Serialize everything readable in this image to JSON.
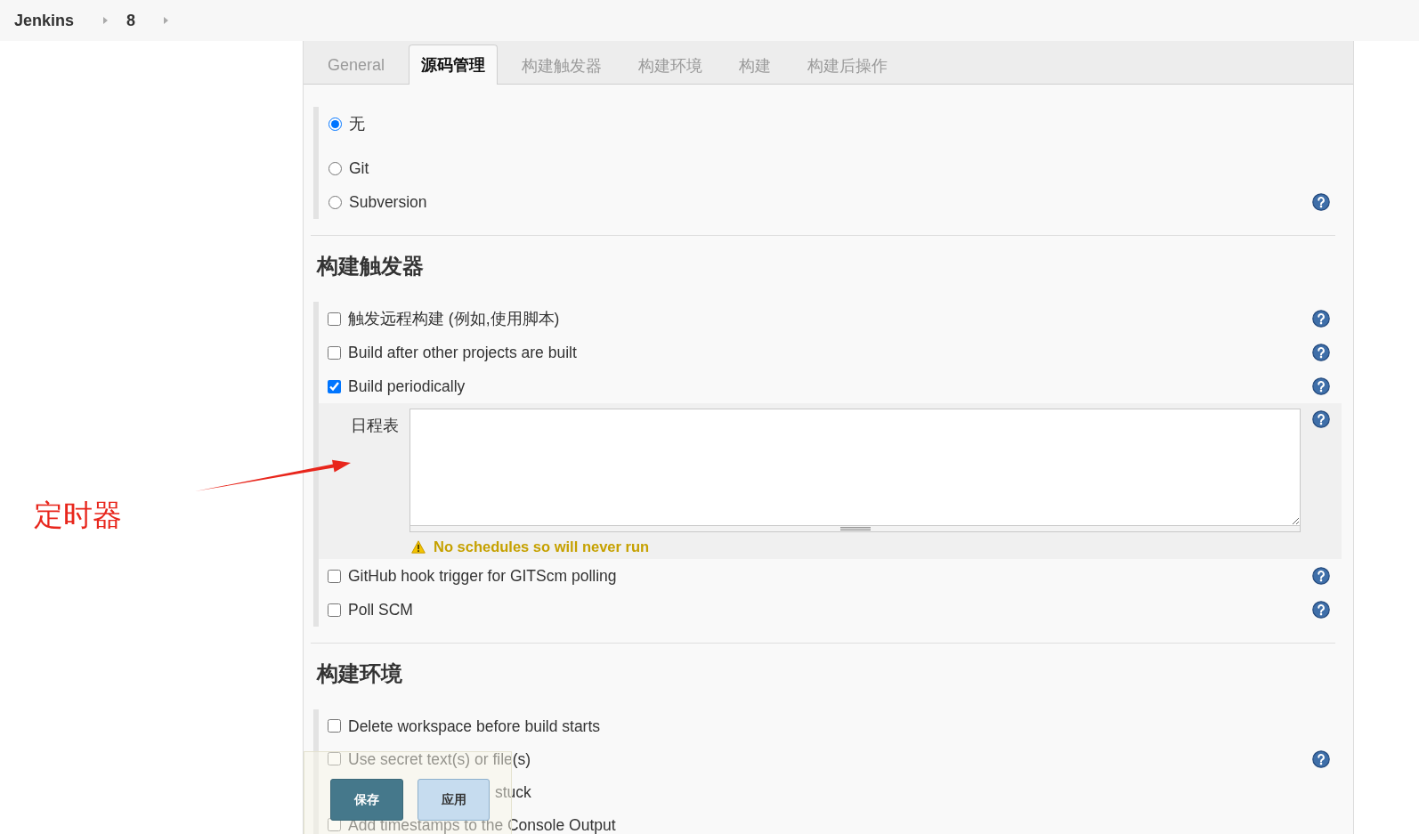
{
  "breadcrumb": [
    {
      "label": "Jenkins"
    },
    {
      "label": "8"
    }
  ],
  "tabs": [
    {
      "label": "General",
      "selected": false
    },
    {
      "label": "源码管理",
      "selected": true
    },
    {
      "label": "构建触发器",
      "selected": false
    },
    {
      "label": "构建环境",
      "selected": false
    },
    {
      "label": "构建",
      "selected": false
    },
    {
      "label": "构建后操作",
      "selected": false
    }
  ],
  "source_control": {
    "options": [
      {
        "label": "无",
        "selected": true
      },
      {
        "label": "Git",
        "selected": false
      },
      {
        "label": "Subversion",
        "selected": false,
        "help": true
      }
    ]
  },
  "sections": [
    {
      "title": "构建触发器",
      "items": [
        {
          "kind": "checkbox",
          "label": "触发远程构建 (例如,使用脚本)",
          "checked": false,
          "help": true
        },
        {
          "kind": "checkbox",
          "label": "Build after other projects are built",
          "checked": false,
          "help": true
        },
        {
          "kind": "checkbox",
          "label": "Build periodically",
          "checked": true,
          "help": true,
          "schedule": {
            "label": "日程表",
            "help": true,
            "warning": "No schedules so will never run"
          }
        },
        {
          "kind": "checkbox",
          "label": "GitHub hook trigger for GITScm polling",
          "checked": false,
          "help": true
        },
        {
          "kind": "checkbox",
          "label": "Poll SCM",
          "checked": false,
          "help": true
        }
      ]
    },
    {
      "title": "构建环境",
      "items": [
        {
          "kind": "checkbox",
          "label": "Delete workspace before build starts",
          "checked": false
        },
        {
          "kind": "checkbox",
          "label": "Use secret text(s) or file(s)",
          "checked": false,
          "help": true
        },
        {
          "kind": "fragment",
          "label": "stuck"
        },
        {
          "kind": "checkbox",
          "label": "Add timestamps to the Console Output",
          "checked": false
        }
      ]
    }
  ],
  "footer": {
    "buttons": [
      {
        "label": "保存",
        "kind": "primary"
      },
      {
        "label": "应用",
        "kind": "secondary"
      }
    ]
  },
  "annotation": {
    "label": "定时器"
  }
}
